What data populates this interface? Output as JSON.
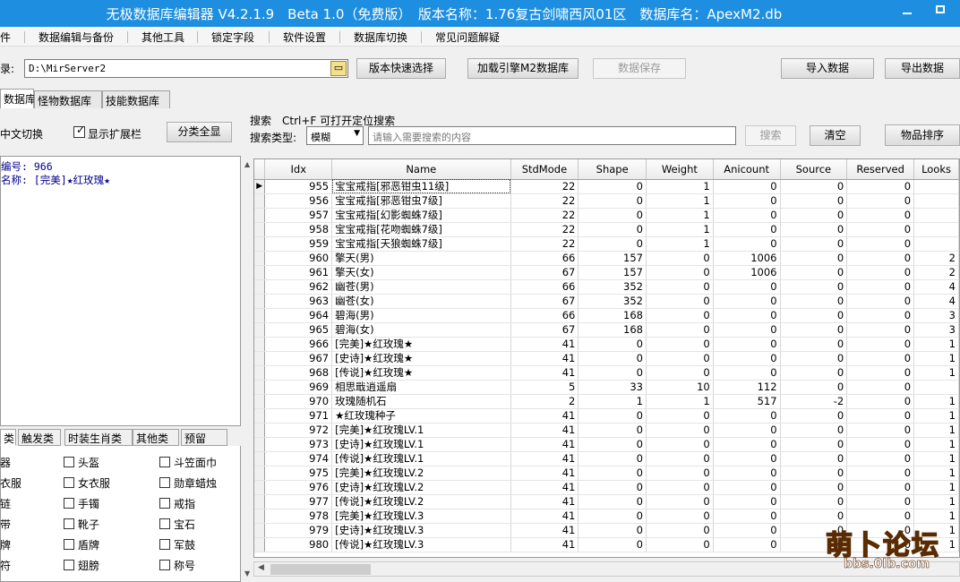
{
  "window": {
    "title": "无极数据库编辑器 V4.2.1.9　Beta 1.0（免费版）　版本名称：1.76复古剑啸西风01区　数据库名：ApexM2.db",
    "min_glyph": "—"
  },
  "menu": [
    "件",
    "数据编辑与备份",
    "其他工具",
    "锁定字段",
    "软件设置",
    "数据库切换",
    "常见问题解疑"
  ],
  "toolbar": {
    "dir_label": "录:",
    "dir_value": "D:\\MirServer2",
    "btn_version": "版本快速选择",
    "btn_load": "加载引擎M2数据库",
    "btn_save": "数据保存",
    "btn_import": "导入数据",
    "btn_export": "导出数据"
  },
  "tabs": [
    "数据库",
    "怪物数据库",
    "技能数据库"
  ],
  "options": {
    "cn_switch": "中文切换",
    "show_ext": "显示扩展栏",
    "btn_all": "分类全显"
  },
  "search": {
    "heading": "搜索　Ctrl+F 可打开定位搜索",
    "type_label": "搜索类型:",
    "type_value": "模糊",
    "placeholder": "请输入需要搜索的内容",
    "btn_search": "搜索",
    "btn_clear": "清空",
    "btn_sort": "物品排序"
  },
  "info": {
    "id_line": "编号: 966",
    "name_line": "名称: [完美]★红玫瑰★"
  },
  "category_tabs": [
    "类",
    "触发类",
    "时装生肖类",
    "其他类",
    "预留"
  ],
  "categories": [
    [
      "器",
      "头盔",
      "斗笠面巾"
    ],
    [
      "衣服",
      "女衣服",
      "勋章蜡烛"
    ],
    [
      "链",
      "手镯",
      "戒指"
    ],
    [
      "带",
      "靴子",
      "宝石"
    ],
    [
      "牌",
      "盾牌",
      "军鼓"
    ],
    [
      "符",
      "翅膀",
      "称号"
    ]
  ],
  "table": {
    "columns": [
      "Idx",
      "Name",
      "StdMode",
      "Shape",
      "Weight",
      "Anicount",
      "Source",
      "Reserved",
      "Looks"
    ],
    "rows": [
      [
        "955",
        "宝宝戒指[邪恶钳虫11级]",
        "22",
        "0",
        "1",
        "0",
        "0",
        "0",
        ""
      ],
      [
        "956",
        "宝宝戒指[邪恶钳虫7级]",
        "22",
        "0",
        "1",
        "0",
        "0",
        "0",
        ""
      ],
      [
        "957",
        "宝宝戒指[幻影蜘蛛7级]",
        "22",
        "0",
        "1",
        "0",
        "0",
        "0",
        ""
      ],
      [
        "958",
        "宝宝戒指[花吻蜘蛛7级]",
        "22",
        "0",
        "1",
        "0",
        "0",
        "0",
        ""
      ],
      [
        "959",
        "宝宝戒指[天狼蜘蛛7级]",
        "22",
        "0",
        "1",
        "0",
        "0",
        "0",
        ""
      ],
      [
        "960",
        "擎天(男)",
        "66",
        "157",
        "0",
        "1006",
        "0",
        "0",
        "2"
      ],
      [
        "961",
        "擎天(女)",
        "67",
        "157",
        "0",
        "1006",
        "0",
        "0",
        "2"
      ],
      [
        "962",
        "幽苍(男)",
        "66",
        "352",
        "0",
        "0",
        "0",
        "0",
        "4"
      ],
      [
        "963",
        "幽苍(女)",
        "67",
        "352",
        "0",
        "0",
        "0",
        "0",
        "4"
      ],
      [
        "964",
        "碧海(男)",
        "66",
        "168",
        "0",
        "0",
        "0",
        "0",
        "3"
      ],
      [
        "965",
        "碧海(女)",
        "67",
        "168",
        "0",
        "0",
        "0",
        "0",
        "3"
      ],
      [
        "966",
        "[完美]★红玫瑰★",
        "41",
        "0",
        "0",
        "0",
        "0",
        "0",
        "1"
      ],
      [
        "967",
        "[史诗]★红玫瑰★",
        "41",
        "0",
        "0",
        "0",
        "0",
        "0",
        "1"
      ],
      [
        "968",
        "[传说]★红玫瑰★",
        "41",
        "0",
        "0",
        "0",
        "0",
        "0",
        "1"
      ],
      [
        "969",
        "相思戢逍遥扇",
        "5",
        "33",
        "10",
        "112",
        "0",
        "0",
        ""
      ],
      [
        "970",
        "玫瑰随机石",
        "2",
        "1",
        "1",
        "517",
        "-2",
        "0",
        "1"
      ],
      [
        "971",
        "★红玫瑰种子",
        "41",
        "0",
        "0",
        "0",
        "0",
        "0",
        "1"
      ],
      [
        "972",
        "[完美]★红玫瑰LV.1",
        "41",
        "0",
        "0",
        "0",
        "0",
        "0",
        "1"
      ],
      [
        "973",
        "[史诗]★红玫瑰LV.1",
        "41",
        "0",
        "0",
        "0",
        "0",
        "0",
        "1"
      ],
      [
        "974",
        "[传说]★红玫瑰LV.1",
        "41",
        "0",
        "0",
        "0",
        "0",
        "0",
        "1"
      ],
      [
        "975",
        "[完美]★红玫瑰LV.2",
        "41",
        "0",
        "0",
        "0",
        "0",
        "0",
        "1"
      ],
      [
        "976",
        "[史诗]★红玫瑰LV.2",
        "41",
        "0",
        "0",
        "0",
        "0",
        "0",
        "1"
      ],
      [
        "977",
        "[传说]★红玫瑰LV.2",
        "41",
        "0",
        "0",
        "0",
        "0",
        "0",
        "1"
      ],
      [
        "978",
        "[完美]★红玫瑰LV.3",
        "41",
        "0",
        "0",
        "0",
        "0",
        "0",
        "1"
      ],
      [
        "979",
        "[史诗]★红玫瑰LV.3",
        "41",
        "0",
        "0",
        "0",
        "0",
        "0",
        "1"
      ],
      [
        "980",
        "[传说]★红玫瑰LV.3",
        "41",
        "0",
        "0",
        "0",
        "0",
        "0",
        "1"
      ]
    ]
  },
  "watermark": {
    "main": "萌卜论坛",
    "sub": "bbs.0lb.com"
  }
}
